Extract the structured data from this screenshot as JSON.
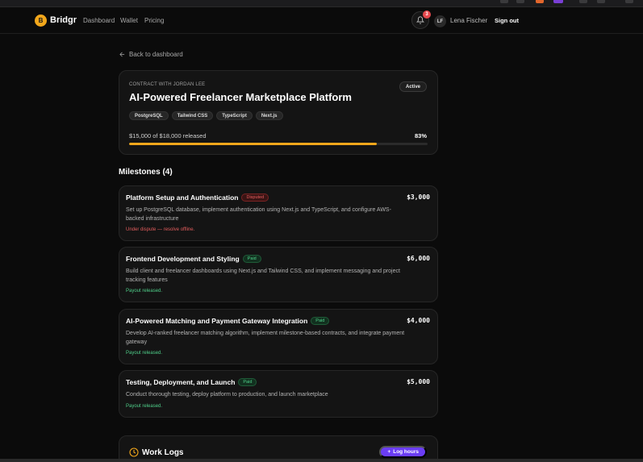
{
  "nav": {
    "logo_letter": "B",
    "brand": "Bridgr",
    "links": [
      "Dashboard",
      "Wallet",
      "Pricing"
    ],
    "notification_count": "3",
    "user_initials": "LF",
    "user_name": "Lena Fischer",
    "sign_out": "Sign out"
  },
  "back_link": "Back to dashboard",
  "contract": {
    "eyebrow": "CONTRACT WITH JORDAN LEE",
    "title": "AI-Powered Freelancer Marketplace Platform",
    "status": "Active",
    "tags": [
      "PostgreSQL",
      "Tailwind CSS",
      "TypeScript",
      "Next.js"
    ],
    "released_text": "$15,000 of $18,000 released",
    "percent_text": "83%",
    "progress_fraction": 0.83,
    "progress_color": "#f2a71b"
  },
  "milestones_heading": "Milestones (4)",
  "milestones": [
    {
      "title": "Platform Setup and Authentication",
      "status": "Disputed",
      "amount": "$3,000",
      "description": "Set up PostgreSQL database, implement authentication using Next.js and TypeScript, and configure AWS-backed infrastructure",
      "note": "Under dispute — resolve offline."
    },
    {
      "title": "Frontend Development and Styling",
      "status": "Paid",
      "amount": "$6,000",
      "description": "Build client and freelancer dashboards using Next.js and Tailwind CSS, and implement messaging and project tracking features",
      "note": "Payout released."
    },
    {
      "title": "AI-Powered Matching and Payment Gateway Integration",
      "status": "Paid",
      "amount": "$4,000",
      "description": "Develop AI-ranked freelancer matching algorithm, implement milestone-based contracts, and integrate payment gateway",
      "note": "Payout released."
    },
    {
      "title": "Testing, Deployment, and Launch",
      "status": "Paid",
      "amount": "$5,000",
      "description": "Conduct thorough testing, deploy platform to production, and launch marketplace",
      "note": "Payout released."
    }
  ],
  "work_logs": {
    "title": "Work Logs",
    "button": "Log hours"
  },
  "colors": {
    "accent": "#f2a71b",
    "button_purple": "#6b3df5",
    "disputed": "#e35d5d",
    "paid": "#4fd08a"
  },
  "icons": [
    "bell-icon",
    "arrow-left-icon",
    "clock-icon",
    "plus-icon"
  ]
}
